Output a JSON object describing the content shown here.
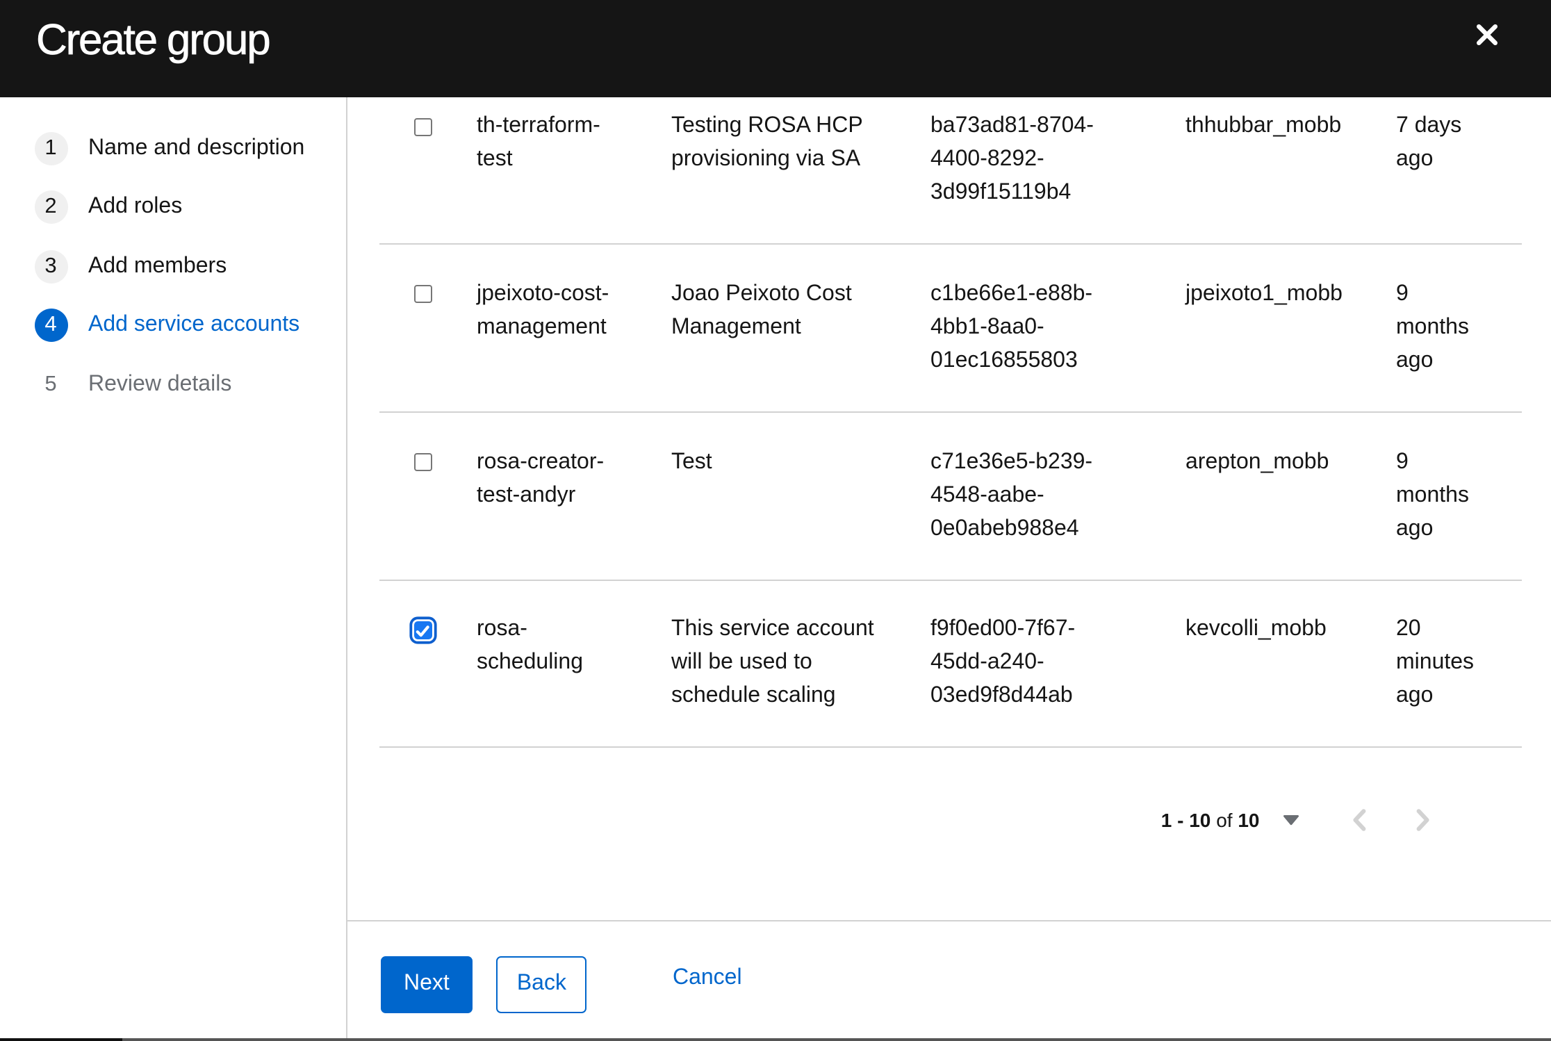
{
  "header": {
    "title": "Create group"
  },
  "wizard_nav": {
    "steps": [
      {
        "number": "1",
        "label": "Name and description",
        "state": "visited"
      },
      {
        "number": "2",
        "label": "Add roles",
        "state": "visited"
      },
      {
        "number": "3",
        "label": "Add members",
        "state": "visited"
      },
      {
        "number": "4",
        "label": "Add service accounts",
        "state": "current"
      },
      {
        "number": "5",
        "label": "Review details",
        "state": "disabled"
      }
    ]
  },
  "table": {
    "rows": [
      {
        "checked": false,
        "name": "th-terraform-test",
        "description": "Testing ROSA HCP provisioning via SA",
        "client_id": "ba73ad81-8704-4400-8292-3d99f15119b4",
        "owner": "thhubbar_mobb",
        "time_created": "7 days ago"
      },
      {
        "checked": false,
        "name": "jpeixoto-cost-management",
        "description": "Joao Peixoto Cost Management",
        "client_id": "c1be66e1-e88b-4bb1-8aa0-01ec16855803",
        "owner": "jpeixoto1_mobb",
        "time_created": "9 months ago"
      },
      {
        "checked": false,
        "name": "rosa-creator-test-andyr",
        "description": "Test",
        "client_id": "c71e36e5-b239-4548-aabe-0e0abeb988e4",
        "owner": "arepton_mobb",
        "time_created": "9 months ago"
      },
      {
        "checked": true,
        "name": "rosa-scheduling",
        "description": "This service account will be used to schedule scaling",
        "client_id": "f9f0ed00-7f67-45dd-a240-03ed9f8d44ab",
        "owner": "kevcolli_mobb",
        "time_created": "20 minutes ago"
      }
    ]
  },
  "pagination": {
    "range": "1 - 10",
    "of_label": "of",
    "total": "10"
  },
  "footer": {
    "next_label": "Next",
    "back_label": "Back",
    "cancel_label": "Cancel"
  },
  "colors": {
    "primary": "#0066cc",
    "header_bg": "#151515",
    "divider": "#d2d2d2",
    "muted": "#6a6e73",
    "checkbox_accent": "#1672e6",
    "disabled_icon": "#d2d2d2"
  }
}
